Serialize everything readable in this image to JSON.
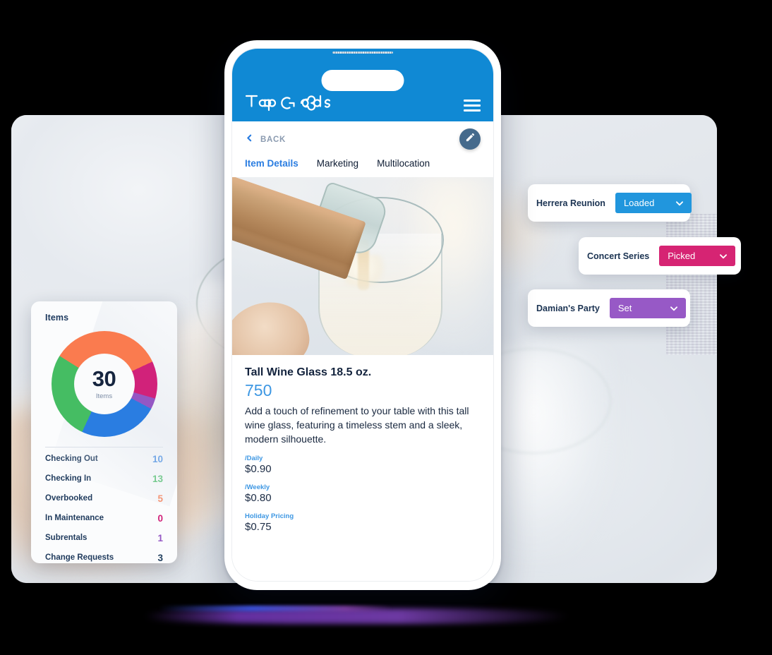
{
  "background": {
    "photo_description": "champagne-pouring-into-glass"
  },
  "items_card": {
    "title": "Items",
    "donut": {
      "center_value": "30",
      "center_label": "Items"
    },
    "stats": [
      {
        "label": "Checking Out",
        "value": "10",
        "color": "#2a7de1"
      },
      {
        "label": "Checking In",
        "value": "13",
        "color": "#45bd63"
      },
      {
        "label": "Overbooked",
        "value": "5",
        "color": "#fa7b4f"
      },
      {
        "label": "In Maintenance",
        "value": "0",
        "color": "#d1227a"
      },
      {
        "label": "Subrentals",
        "value": "1",
        "color": "#9457c4"
      },
      {
        "label": "Change Requests",
        "value": "3",
        "color": "#22405f"
      }
    ]
  },
  "chart_data": {
    "type": "pie",
    "title": "Items",
    "center_value": 30,
    "center_label": "Items",
    "categories": [
      "Checking Out",
      "Checking In",
      "Overbooked",
      "In Maintenance",
      "Subrentals",
      "Change Requests"
    ],
    "values": [
      10,
      13,
      5,
      0,
      1,
      3
    ],
    "colors": [
      "#2a7de1",
      "#45bd63",
      "#fa7b4f",
      "#d1227a",
      "#9457c4",
      "#22405f"
    ],
    "segments_drawn": [
      {
        "name": "Overbooked",
        "color": "#fa7b4f",
        "start_deg": 302,
        "end_deg": 65
      },
      {
        "name": "In Maintenance",
        "color": "#d1227a",
        "start_deg": 65,
        "end_deg": 106
      },
      {
        "name": "Subrentals",
        "color": "#9457c4",
        "start_deg": 106,
        "end_deg": 118
      },
      {
        "name": "Checking Out",
        "color": "#2a7de1",
        "start_deg": 118,
        "end_deg": 205
      },
      {
        "name": "Checking In",
        "color": "#45bd63",
        "start_deg": 205,
        "end_deg": 302
      }
    ],
    "legend_position": "below",
    "grid": false
  },
  "status_cards": [
    {
      "name": "Herrera Reunion",
      "status": "Loaded",
      "color": "#2196dd",
      "caret": "chevron-down-icon"
    },
    {
      "name": "Concert Series",
      "status": "Picked",
      "color": "#d62473",
      "caret": "chevron-down-icon"
    },
    {
      "name": "Damian's Party",
      "status": "Set",
      "color": "#9759c6",
      "caret": "chevron-down-icon"
    }
  ],
  "phone": {
    "app_bar": {
      "logo_text": "TapGoods",
      "menu_icon": "hamburger-icon",
      "background_color": "#1089d4"
    },
    "back": {
      "label": "BACK",
      "icon": "chevron-left-icon"
    },
    "edit_button": {
      "icon": "pencil-icon",
      "color": "#456a8c"
    },
    "tabs": [
      {
        "label": "Item Details",
        "active": true
      },
      {
        "label": "Marketing",
        "active": false
      },
      {
        "label": "Multilocation",
        "active": false
      }
    ],
    "hero_image_alt": "champagne-bottle-pouring-into-wine-glass",
    "item": {
      "title": "Tall Wine Glass 18.5 oz.",
      "sku": "750",
      "description": "Add a touch of refinement to your table with this tall wine glass, featuring a timeless stem and a sleek, modern silhouette.",
      "prices": [
        {
          "label": "/Daily",
          "value": "$0.90"
        },
        {
          "label": "/Weekly",
          "value": "$0.80"
        },
        {
          "label": "Holiday Pricing",
          "value": "$0.75"
        }
      ]
    }
  }
}
